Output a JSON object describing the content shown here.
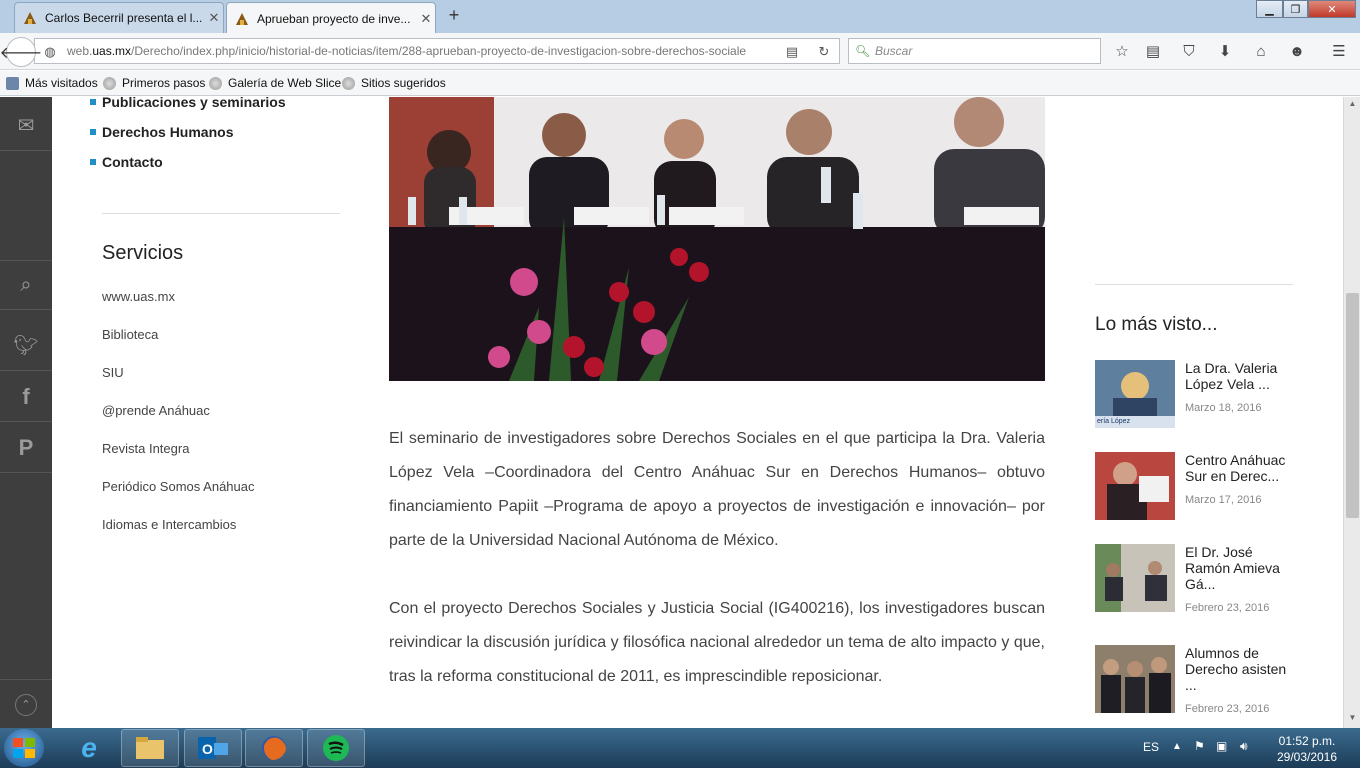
{
  "browser": {
    "tabs": [
      {
        "title": "Carlos Becerril presenta el l..."
      },
      {
        "title": "Aprueban proyecto de inve..."
      }
    ],
    "url": {
      "prefix": "web.",
      "host": "uas.mx",
      "path": "/Derecho/index.php/inicio/historial-de-noticias/item/288-aprueban-proyecto-de-investigacion-sobre-derechos-sociale"
    },
    "search_placeholder": "Buscar",
    "bookmarks": [
      "Más visitados",
      "Primeros pasos",
      "Galería de Web Slice",
      "Sitios sugeridos"
    ]
  },
  "page": {
    "menu": [
      "Publicaciones y seminarios",
      "Derechos Humanos",
      "Contacto"
    ],
    "services_title": "Servicios",
    "services": [
      "www.uas.mx",
      "Biblioteca",
      "SIU",
      "@prende Anáhuac",
      "Revista Integra",
      "Periódico Somos Anáhuac",
      "Idiomas e Intercambios"
    ],
    "article": [
      "El seminario de investigadores sobre Derechos Sociales en el que participa la Dra. Valeria López Vela –Coordinadora del Centro Anáhuac Sur en Derechos Humanos– obtuvo financiamiento Papiit –Programa de apoyo a proyectos de investigación e innovación– por parte de la Universidad Nacional Autónoma de México.",
      "Con el proyecto Derechos Sociales y Justicia Social (IG400216), los investigadores buscan reivindicar la discusión jurídica y filosófica nacional alrededor un tema de alto impacto y que, tras la reforma constitucional de 2011, es imprescindible reposicionar."
    ],
    "most_viewed_title": "Lo más visto...",
    "most_viewed": [
      {
        "title": "La Dra. Valeria López Vela ...",
        "date": "Marzo 18, 2016",
        "thumb_caption": "ería López"
      },
      {
        "title": "Centro Anáhuac Sur en Derec...",
        "date": "Marzo 17, 2016"
      },
      {
        "title": "El Dr. José Ramón Amieva Gá...",
        "date": "Febrero 23, 2016"
      },
      {
        "title": "Alumnos de Derecho asisten ...",
        "date": "Febrero 23, 2016"
      }
    ]
  },
  "taskbar": {
    "lang": "ES",
    "time": "01:52 p.m.",
    "date": "29/03/2016"
  },
  "colors": {
    "accent": "#1f8fc6",
    "social_bar": "#3e3e3e",
    "taskbar": "#1d3c57"
  }
}
